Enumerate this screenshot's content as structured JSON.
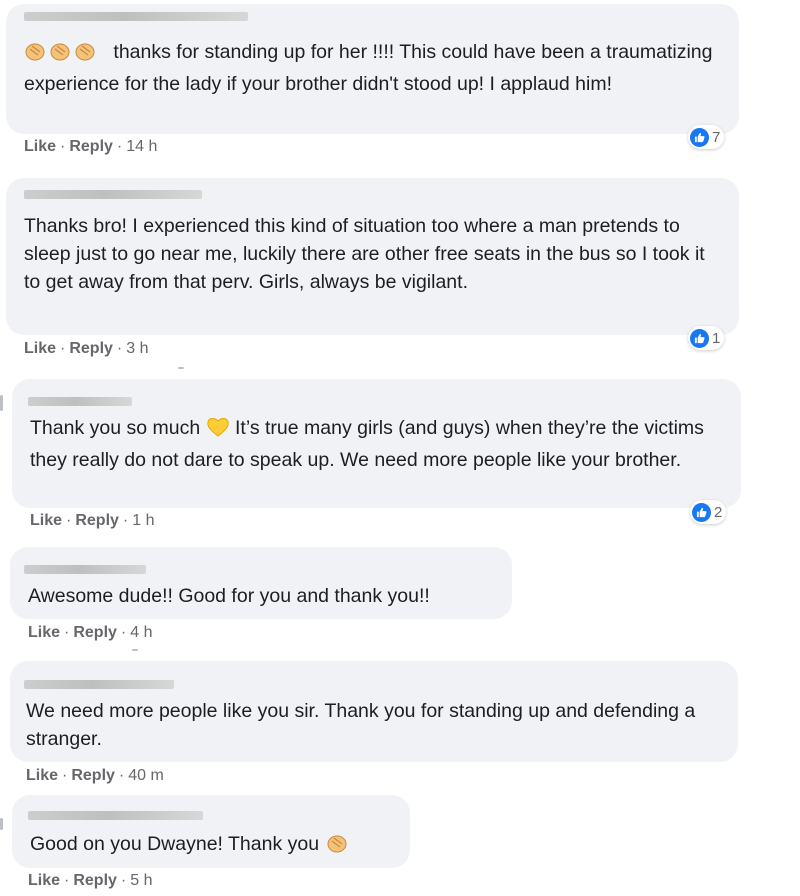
{
  "comments": [
    {
      "text_before": "",
      "text_after": " thanks for standing up for her !!!! This could have been a traumatizing experience for the lady if your brother didn't stood up! I applaud him!",
      "like_label": "Like",
      "reply_label": "Reply",
      "time": "14 h",
      "reaction_count": "7",
      "reaction_icon": "like-icon",
      "emoji": "clapping-hands-icon"
    },
    {
      "text": "Thanks bro! I experienced this kind of situation too where a man pretends to sleep just to go near me, luckily there are other free seats in the bus so I took it to get away from that perv. Girls, always be vigilant.",
      "like_label": "Like",
      "reply_label": "Reply",
      "time": "3 h",
      "reaction_count": "1",
      "reaction_icon": "like-icon"
    },
    {
      "text_before": "Thank you so much ",
      "text_after": " It’s true many girls (and guys) when they’re the victims they really do not dare to speak up. We need more people like your brother.",
      "like_label": "Like",
      "reply_label": "Reply",
      "time": "1 h",
      "reaction_count": "2",
      "reaction_icon": "like-icon",
      "emoji": "yellow-heart-icon"
    },
    {
      "text": "Awesome dude!! Good for you and thank you!!",
      "like_label": "Like",
      "reply_label": "Reply",
      "time": "4 h"
    },
    {
      "text": "We need more people like you sir. Thank you for standing up and defending a stranger.",
      "like_label": "Like",
      "reply_label": "Reply",
      "time": "40 m"
    },
    {
      "text_before": "Good on you Dwayne! Thank you ",
      "text_after": "",
      "like_label": "Like",
      "reply_label": "Reply",
      "time": "5 h",
      "emoji": "clapping-hands-icon"
    }
  ],
  "separator": "·",
  "colors": {
    "bubble": "#f0f2f5",
    "meta_text": "#65676b",
    "like_blue": "#1877f2",
    "body_text": "#1c1e21"
  }
}
